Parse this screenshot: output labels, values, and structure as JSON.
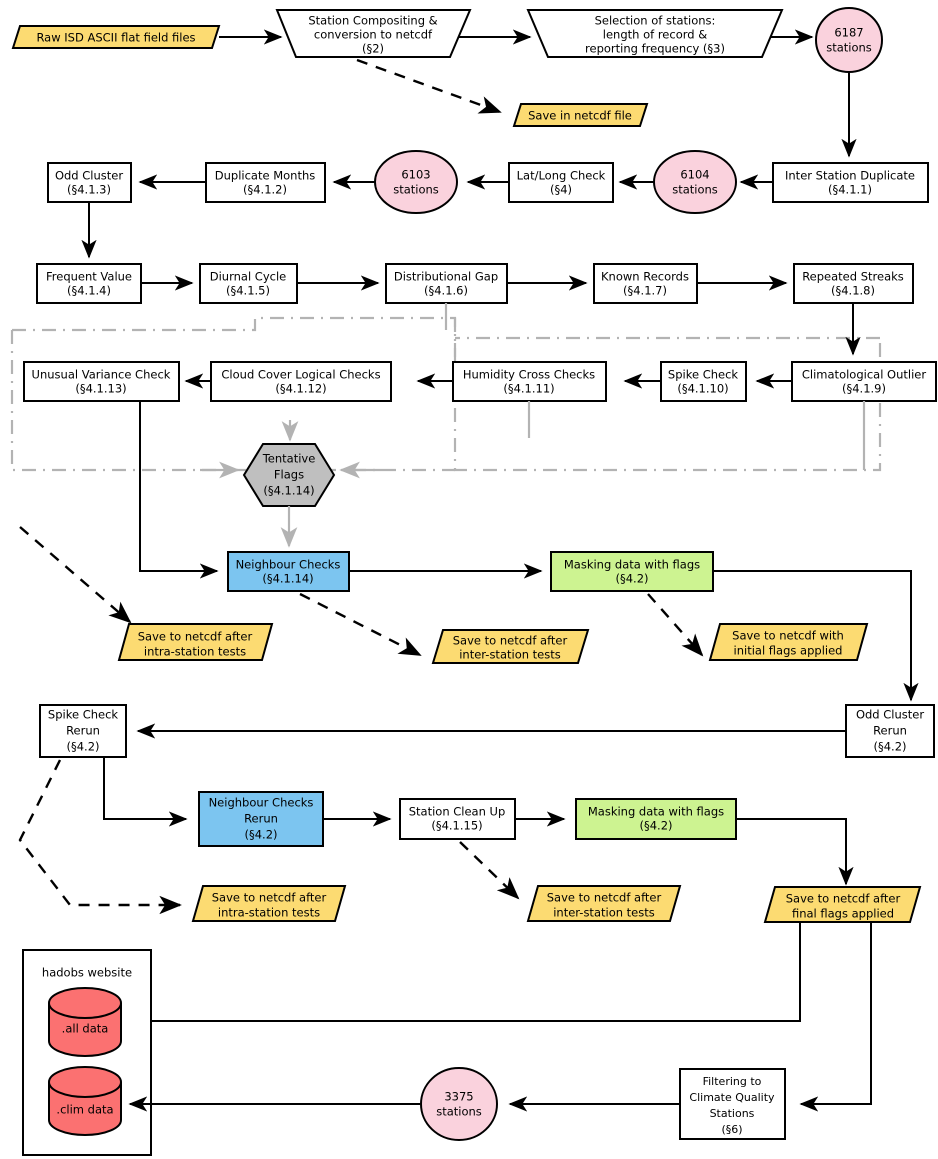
{
  "diagram": {
    "title": "HadISD quality control processing flowchart",
    "colors": {
      "yellow": "#fcdb72",
      "pink": "#fad2dd",
      "blue": "#7cc5f0",
      "green": "#cdf391",
      "gray": "#bfbfbf",
      "red": "#fb7171",
      "white": "#ffffff",
      "outline": "#000000",
      "boundary": "#b3b3b3"
    },
    "nodes": {
      "raw_files": {
        "label": "Raw ISD ASCII flat field files",
        "shape": "parallelogram",
        "fill": "yellow"
      },
      "station_compositing": {
        "line1": "Station Compositing &",
        "line2": "conversion to netcdf",
        "line3": "(§2)",
        "shape": "trapezoid",
        "fill": "white"
      },
      "selection_stations": {
        "line1": "Selection of stations:",
        "line2": "length of record &",
        "line3": "reporting frequency (§3)",
        "shape": "trapezoid",
        "fill": "white"
      },
      "save_netcdf_file": {
        "label": "Save in netcdf file",
        "shape": "parallelogram",
        "fill": "yellow"
      },
      "stations_6187": {
        "line1": "6187",
        "line2": "stations",
        "shape": "ellipse",
        "fill": "pink"
      },
      "inter_station_duplicate": {
        "line1": "Inter Station Duplicate",
        "line2": "(§4.1.1)",
        "shape": "rect",
        "fill": "white"
      },
      "stations_6104": {
        "line1": "6104",
        "line2": "stations",
        "shape": "ellipse",
        "fill": "pink"
      },
      "latlong_check": {
        "line1": "Lat/Long Check",
        "line2": "(§4)",
        "shape": "rect",
        "fill": "white"
      },
      "stations_6103": {
        "line1": "6103",
        "line2": "stations",
        "shape": "ellipse",
        "fill": "pink"
      },
      "duplicate_months": {
        "line1": "Duplicate Months",
        "line2": "(§4.1.2)",
        "shape": "rect",
        "fill": "white"
      },
      "odd_cluster": {
        "line1": "Odd Cluster",
        "line2": "(§4.1.3)",
        "shape": "rect",
        "fill": "white"
      },
      "frequent_value": {
        "line1": "Frequent Value",
        "line2": "(§4.1.4)",
        "shape": "rect",
        "fill": "white"
      },
      "diurnal_cycle": {
        "line1": "Diurnal Cycle",
        "line2": "(§4.1.5)",
        "shape": "rect",
        "fill": "white"
      },
      "distributional_gap": {
        "line1": "Distributional Gap",
        "line2": "(§4.1.6)",
        "shape": "rect",
        "fill": "white"
      },
      "known_records": {
        "line1": "Known Records",
        "line2": "(§4.1.7)",
        "shape": "rect",
        "fill": "white"
      },
      "repeated_streaks": {
        "line1": "Repeated Streaks",
        "line2": "(§4.1.8)",
        "shape": "rect",
        "fill": "white"
      },
      "climatological_outlier": {
        "line1": "Climatological Outlier",
        "line2": "(§4.1.9)",
        "shape": "rect",
        "fill": "white"
      },
      "spike_check": {
        "line1": "Spike Check",
        "line2": "(§4.1.10)",
        "shape": "rect",
        "fill": "white"
      },
      "humidity_cross_checks": {
        "line1": "Humidity Cross Checks",
        "line2": "(§4.1.11)",
        "shape": "rect",
        "fill": "white"
      },
      "cloud_cover_logical_checks": {
        "line1": "Cloud Cover Logical Checks",
        "line2": "(§4.1.12)",
        "shape": "rect",
        "fill": "white"
      },
      "unusual_variance_check": {
        "line1": "Unusual Variance Check",
        "line2": "(§4.1.13)",
        "shape": "rect",
        "fill": "white"
      },
      "tentative_flags": {
        "line1": "Tentative",
        "line2": "Flags",
        "line3": "(§4.1.14)",
        "shape": "hexagon",
        "fill": "gray"
      },
      "neighbour_checks": {
        "line1": "Neighbour Checks",
        "line2": "(§4.1.14)",
        "shape": "rect",
        "fill": "blue"
      },
      "masking_initial": {
        "line1": "Masking data with flags",
        "line2": "(§4.2)",
        "shape": "rect",
        "fill": "green"
      },
      "save_intra_1": {
        "line1": "Save to netcdf after",
        "line2": "intra-station tests",
        "shape": "parallelogram",
        "fill": "yellow"
      },
      "save_inter_1": {
        "line1": "Save to netcdf after",
        "line2": "inter-station tests",
        "shape": "parallelogram",
        "fill": "yellow"
      },
      "save_initial_flags": {
        "line1": "Save to netcdf with",
        "line2": "initial flags applied",
        "shape": "parallelogram",
        "fill": "yellow"
      },
      "odd_cluster_rerun": {
        "line1": "Odd Cluster",
        "line2": "Rerun",
        "line3": "(§4.2)",
        "shape": "rect",
        "fill": "white"
      },
      "spike_check_rerun": {
        "line1": "Spike Check",
        "line2": "Rerun",
        "line3": "(§4.2)",
        "shape": "rect",
        "fill": "white"
      },
      "neighbour_checks_rerun": {
        "line1": "Neighbour Checks",
        "line2": "Rerun",
        "line3": "(§4.2)",
        "shape": "rect",
        "fill": "blue"
      },
      "station_clean_up": {
        "line1": "Station Clean Up",
        "line2": "(§4.1.15)",
        "shape": "rect",
        "fill": "white"
      },
      "masking_final": {
        "line1": "Masking data with flags",
        "line2": "(§4.2)",
        "shape": "rect",
        "fill": "green"
      },
      "save_intra_2": {
        "line1": "Save to netcdf after",
        "line2": "intra-station tests",
        "shape": "parallelogram",
        "fill": "yellow"
      },
      "save_inter_2": {
        "line1": "Save to netcdf after",
        "line2": "inter-station tests",
        "shape": "parallelogram",
        "fill": "yellow"
      },
      "save_final_flags": {
        "line1": "Save to netcdf after",
        "line2": "final flags applied",
        "shape": "parallelogram",
        "fill": "yellow"
      },
      "hadobs_website": {
        "label": "hadobs website",
        "shape": "container",
        "fill": "white"
      },
      "all_data": {
        "label": ".all data",
        "shape": "cylinder",
        "fill": "red"
      },
      "clim_data": {
        "label": ".clim data",
        "shape": "cylinder",
        "fill": "red"
      },
      "stations_3375": {
        "line1": "3375",
        "line2": "stations",
        "shape": "ellipse",
        "fill": "pink"
      },
      "filtering_climate_quality": {
        "line1": "Filtering to",
        "line2": "Climate Quality",
        "line3": "Stations",
        "line4": "(§6)",
        "shape": "rect",
        "fill": "white"
      }
    }
  }
}
